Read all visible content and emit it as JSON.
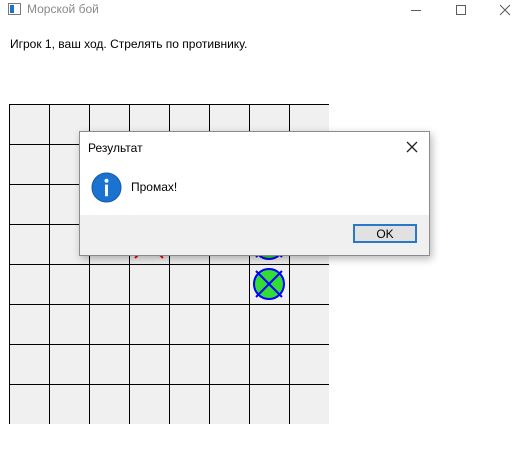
{
  "window": {
    "title": "Морской бой",
    "icon": "app-icon",
    "controls": [
      "minimize-icon",
      "maximize-icon",
      "close-icon"
    ]
  },
  "status": "Игрок 1, ваш ход. Стрелять по противнику.",
  "dialog": {
    "title": "Результат",
    "message": "Промах!",
    "icon": "info-icon",
    "ok_label": "OK"
  },
  "colors": {
    "ship_fill": "#33dd33",
    "ship_outline": "#0000ff",
    "miss_mark": "#ff0000",
    "board_bg": "#f0f0f0",
    "button_focus": "#2a79c9"
  }
}
